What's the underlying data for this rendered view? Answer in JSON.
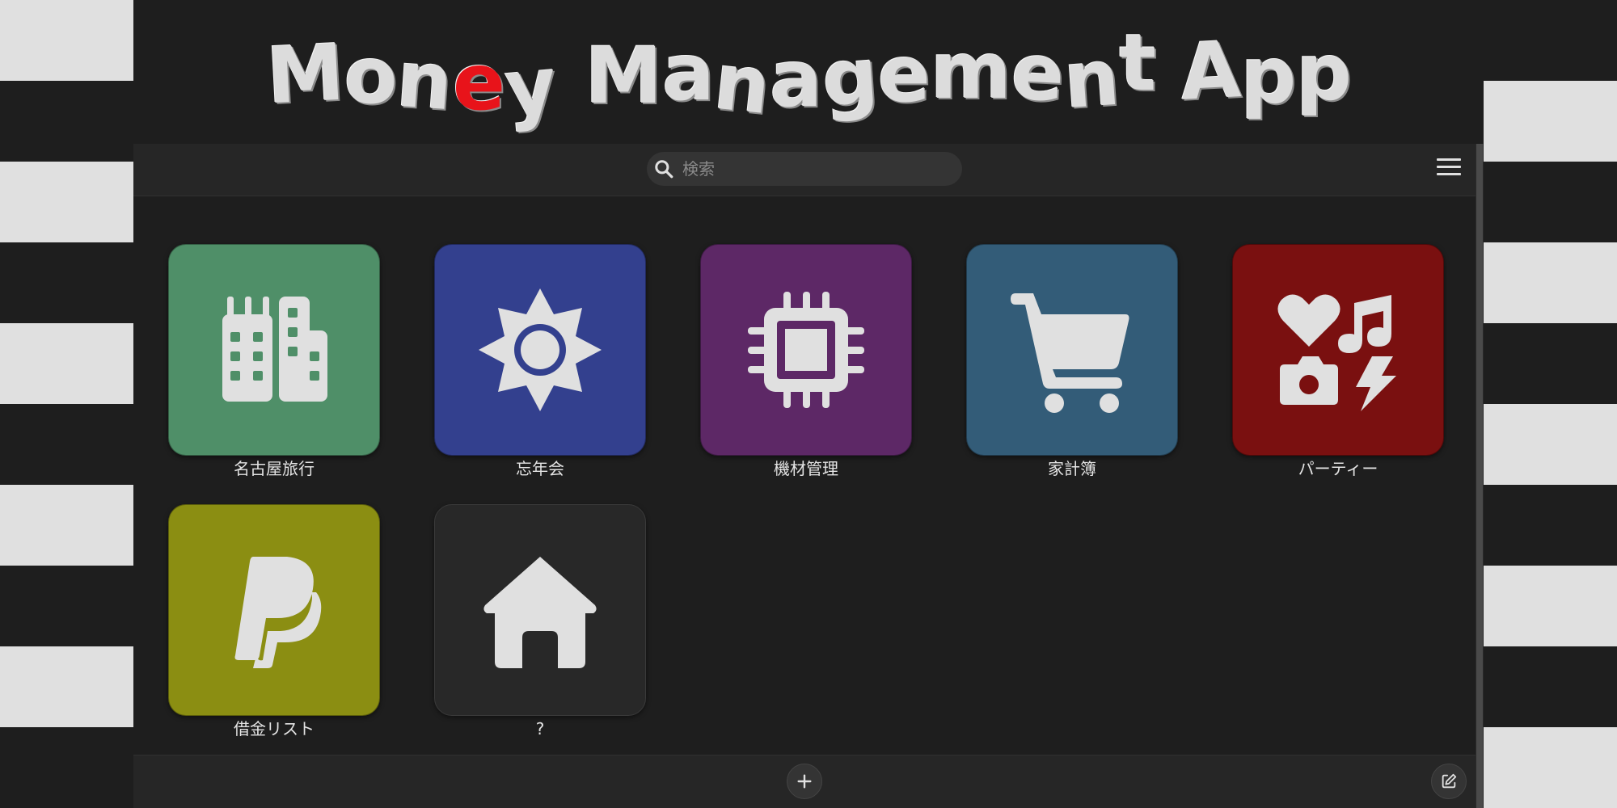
{
  "header": {
    "title_letters": [
      "M",
      "o",
      "n",
      "e",
      "y",
      " ",
      "M",
      "a",
      "n",
      "a",
      "g",
      "e",
      "m",
      "e",
      "n",
      "t",
      " ",
      "A",
      "p",
      "p"
    ],
    "accent_letter_color": "#e8131a"
  },
  "search": {
    "placeholder": "検索",
    "value": "",
    "icon": "search-icon"
  },
  "menu": {
    "icon": "hamburger-menu-icon"
  },
  "tiles": [
    {
      "label": "名古屋旅行",
      "icon": "city-buildings-icon",
      "color": "#4f8f68"
    },
    {
      "label": "忘年会",
      "icon": "sun-icon",
      "color": "#33408e"
    },
    {
      "label": "機材管理",
      "icon": "microchip-icon",
      "color": "#5d2866"
    },
    {
      "label": "家計簿",
      "icon": "shopping-cart-icon",
      "color": "#335c78"
    },
    {
      "label": "パーティー",
      "icon": "icons-heart-music-camera-bolt-icon",
      "color": "#7a1010"
    },
    {
      "label": "借金リスト",
      "icon": "paypal-icon",
      "color": "#8b8e12"
    },
    {
      "label": "?",
      "icon": "house-icon",
      "color": "#282828"
    }
  ],
  "bottom": {
    "add_icon": "plus-icon",
    "edit_icon": "edit-icon"
  },
  "colors": {
    "background": "#1e1e1e",
    "bar": "#262626",
    "stripe": "#e0e0e0",
    "icon_fill": "#e0e0e0"
  }
}
